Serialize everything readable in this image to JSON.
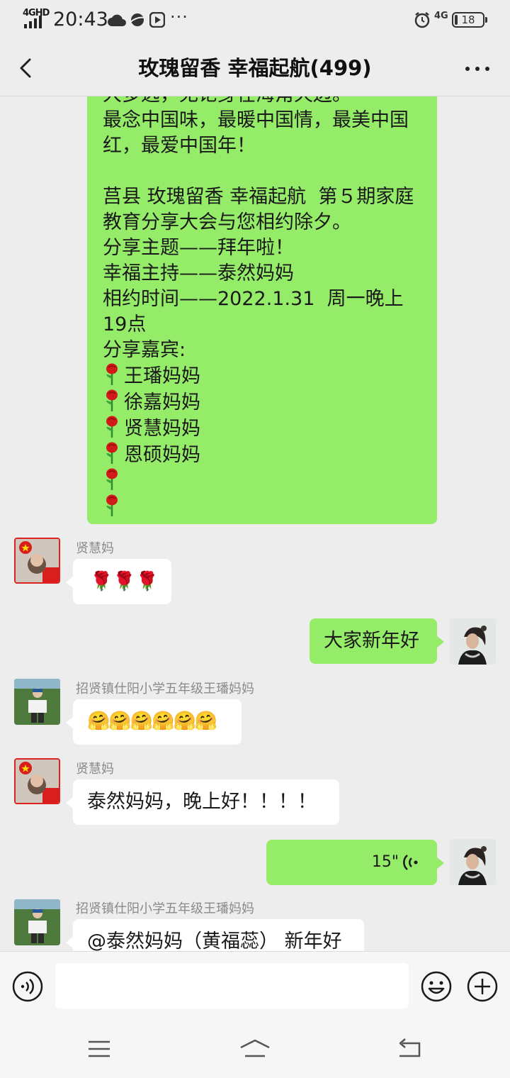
{
  "status": {
    "network": "4GHD",
    "time": "20:43",
    "signal_right": "4G",
    "battery": "18"
  },
  "header": {
    "title": "玫瑰留香  幸福起航(499)",
    "back_icon": "chevron-left-icon",
    "more_icon": "more-dots-icon"
  },
  "long_message": {
    "lines": [
      "大多远，无论身在海角天边。",
      "最念中国味，最暖中国情，最美中国红，最爱中国年！",
      "",
      "莒县 玫瑰留香 幸福起航  第５期家庭教育分享大会与您相约除夕。",
      "分享主题——拜年啦！",
      "幸福主持——泰然妈妈",
      "相约时间——2022.1.31  周一晚上19点",
      "分享嘉宾:"
    ],
    "guests": [
      "王璠妈妈",
      "徐嘉妈妈",
      "贤慧妈妈",
      "恩硕妈妈",
      "",
      ""
    ]
  },
  "messages": [
    {
      "sender": "贤慧妈",
      "text": "🌹🌹🌹",
      "side": "left"
    },
    {
      "text": "大家新年好",
      "side": "right"
    },
    {
      "sender": "招贤镇仕阳小学五年级王璠妈妈",
      "text": "🤗🤗🤗🤗🤗🤗",
      "side": "left"
    },
    {
      "sender": "贤慧妈",
      "text": "泰然妈妈，晚上好！！！！",
      "side": "left"
    },
    {
      "voice_duration": "15\"",
      "side": "right"
    },
    {
      "sender": "招贤镇仕阳小学五年级王璠妈妈",
      "text": "@泰然妈妈（黄福蕊） 新年好",
      "side": "left"
    }
  ],
  "input": {
    "placeholder": "",
    "voice_icon": "voice-input-icon",
    "emoji_icon": "emoji-icon",
    "plus_icon": "plus-icon"
  },
  "colors": {
    "bubble_self": "#95ec69",
    "bubble_other": "#ffffff",
    "background": "#ededed"
  }
}
